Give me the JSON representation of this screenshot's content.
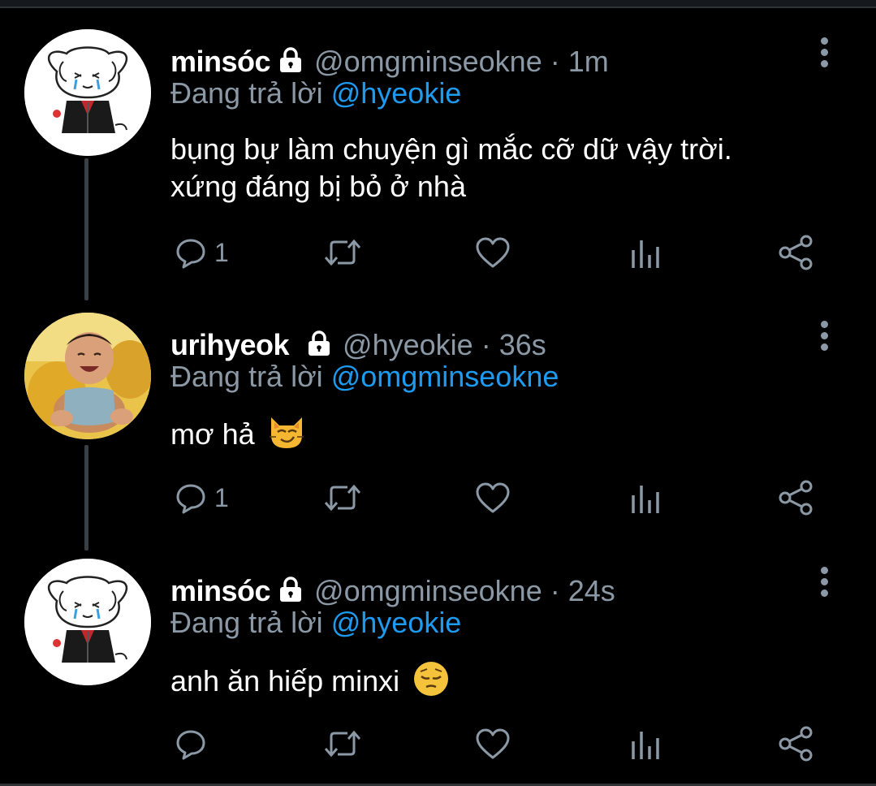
{
  "reply_prefix": "Đang trả lời",
  "tweets": [
    {
      "name": "minsóc",
      "handle": "@omgminseokne",
      "time": "1m",
      "reply_to": "@hyeokie",
      "lines": [
        "bụng bự làm chuyện gì mắc cỡ dữ vậy trời.",
        "xứng đáng bị bỏ ở nhà"
      ],
      "reply_count": "1",
      "avatar": "cartoon-dog",
      "emoji": ""
    },
    {
      "name": "urihyeok",
      "handle": "@hyeokie",
      "time": "36s",
      "reply_to": "@omgminseokne",
      "lines": [
        "mơ hả"
      ],
      "reply_count": "1",
      "avatar": "baby-photo",
      "emoji": "smirk-cat"
    },
    {
      "name": "minsóc",
      "handle": "@omgminseokne",
      "time": "24s",
      "reply_to": "@hyeokie",
      "lines": [
        "anh ăn hiếp minxi"
      ],
      "reply_count": "",
      "avatar": "cartoon-dog",
      "emoji": "pensive-face"
    }
  ],
  "colors": {
    "background": "#000000",
    "text": "#ffffff",
    "secondary": "#8b98a5",
    "mention": "#1d9bf0",
    "thread_line": "#3a3f44"
  }
}
